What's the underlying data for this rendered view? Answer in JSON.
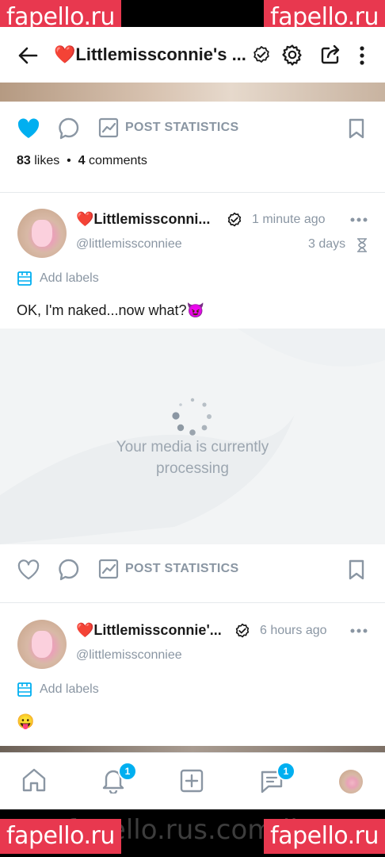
{
  "watermark": {
    "text": "fapello.ru"
  },
  "url_bar": {
    "text": "fapello.rus.com/litt"
  },
  "header": {
    "title": "❤️Littlemissconnie's ..."
  },
  "post1": {
    "stats_label": "POST STATISTICS",
    "likes_count": "83",
    "likes_word": "likes",
    "separator": "•",
    "comments_count": "4",
    "comments_word": "comments"
  },
  "post2": {
    "name": "❤️Littlemissconni...",
    "time": "1 minute ago",
    "handle": "@littlemissconniee",
    "expiry": "3 days",
    "labels": "Add labels",
    "text": "OK, I'm naked...now what?😈",
    "media_message_line1": "Your media is currently",
    "media_message_line2": "processing",
    "stats_label": "POST STATISTICS"
  },
  "post3": {
    "name": "❤️Littlemissconnie'...",
    "time": "6 hours ago",
    "handle": "@littlemissconniee",
    "labels": "Add labels",
    "text": "😛"
  },
  "nav": {
    "notifications_badge": "1",
    "messages_badge": "1"
  },
  "colors": {
    "accent": "#00aff0",
    "muted": "#8a96a3",
    "watermark": "#e8384f"
  }
}
